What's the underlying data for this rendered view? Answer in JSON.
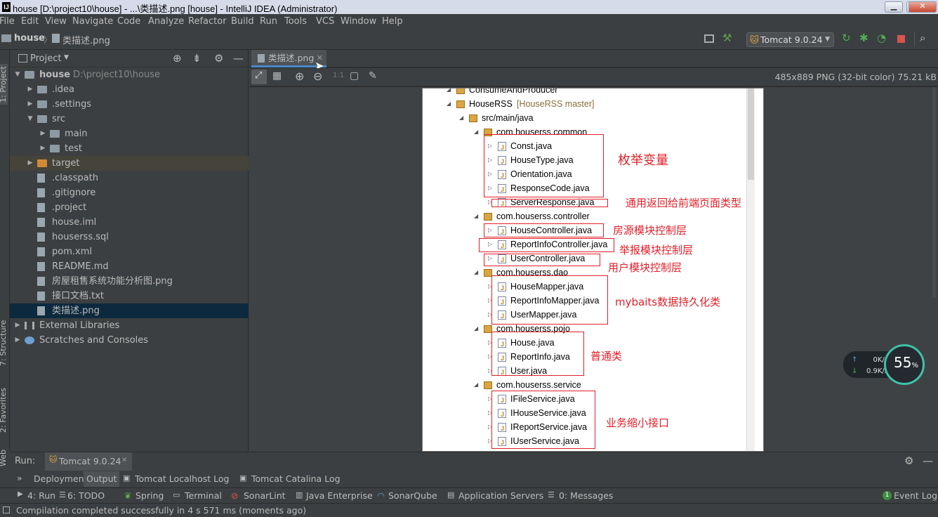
{
  "window": {
    "title": "house [D:\\project10\\house] - ...\\类描述.png [house] - IntelliJ IDEA (Administrator)",
    "logo": "IJ"
  },
  "menu": [
    "File",
    "Edit",
    "View",
    "Navigate",
    "Code",
    "Analyze",
    "Refactor",
    "Build",
    "Run",
    "Tools",
    "VCS",
    "Window",
    "Help"
  ],
  "breadcrumb": {
    "project": "house",
    "file": "类描述.png"
  },
  "toolbar": {
    "run_config": "Tomcat 9.0.24"
  },
  "left_stripe": {
    "project": "1: Project",
    "structure": "7: Structure",
    "favorites": "2: Favorites",
    "web": "Web"
  },
  "project_panel": {
    "title": "Project",
    "tree": [
      {
        "label": "house",
        "extra": "D:\\project10\\house",
        "indent": 0,
        "arrow": "open",
        "icon": "folder"
      },
      {
        "label": ".idea",
        "indent": 1,
        "arrow": "closed",
        "icon": "folder"
      },
      {
        "label": ".settings",
        "indent": 1,
        "arrow": "closed",
        "icon": "folder"
      },
      {
        "label": "src",
        "indent": 1,
        "arrow": "open",
        "icon": "folder"
      },
      {
        "label": "main",
        "indent": 2,
        "arrow": "closed",
        "icon": "folder"
      },
      {
        "label": "test",
        "indent": 2,
        "arrow": "closed",
        "icon": "folder"
      },
      {
        "label": "target",
        "indent": 1,
        "arrow": "closed",
        "icon": "folder-orange",
        "highlight": true
      },
      {
        "label": ".classpath",
        "indent": 1,
        "icon": "file"
      },
      {
        "label": ".gitignore",
        "indent": 1,
        "icon": "file"
      },
      {
        "label": ".project",
        "indent": 1,
        "icon": "file"
      },
      {
        "label": "house.iml",
        "indent": 1,
        "icon": "file"
      },
      {
        "label": "houserss.sql",
        "indent": 1,
        "icon": "file"
      },
      {
        "label": "pom.xml",
        "indent": 1,
        "icon": "file"
      },
      {
        "label": "README.md",
        "indent": 1,
        "icon": "file"
      },
      {
        "label": "房屋租售系统功能分析图.png",
        "indent": 1,
        "icon": "file"
      },
      {
        "label": "接口文档.txt",
        "indent": 1,
        "icon": "file"
      },
      {
        "label": "类描述.png",
        "indent": 1,
        "icon": "file",
        "selected": true
      },
      {
        "label": "External Libraries",
        "indent": 0,
        "arrow": "closed",
        "icon": "lib"
      },
      {
        "label": "Scratches and Consoles",
        "indent": 0,
        "arrow": "closed",
        "icon": "scratch"
      }
    ]
  },
  "editor": {
    "tab_label": "类描述.png",
    "image_info": "485x889 PNG (32-bit color) 75.21 kB",
    "zoom_label": "1:1"
  },
  "image": {
    "rows": [
      {
        "label": "ConsumeAndProducer",
        "level": 0,
        "type": "module"
      },
      {
        "label": "HouseRSS",
        "extra": "[HouseRSS master]",
        "level": 0,
        "type": "module"
      },
      {
        "label": "src/main/java",
        "level": 1,
        "type": "pkg"
      },
      {
        "label": "com.houserss.common",
        "level": 2,
        "type": "pkg"
      },
      {
        "label": "Const.java",
        "level": 3,
        "type": "java"
      },
      {
        "label": "HouseType.java",
        "level": 3,
        "type": "java"
      },
      {
        "label": "Orientation.java",
        "level": 3,
        "type": "java"
      },
      {
        "label": "ResponseCode.java",
        "level": 3,
        "type": "java"
      },
      {
        "label": "ServerResponse.java",
        "level": 3,
        "type": "java"
      },
      {
        "label": "com.houserss.controller",
        "level": 2,
        "type": "pkg"
      },
      {
        "label": "HouseController.java",
        "level": 3,
        "type": "java"
      },
      {
        "label": "ReportInfoController.java",
        "level": 3,
        "type": "java"
      },
      {
        "label": "UserController.java",
        "level": 3,
        "type": "java"
      },
      {
        "label": "com.houserss.dao",
        "level": 2,
        "type": "pkg"
      },
      {
        "label": "HouseMapper.java",
        "level": 3,
        "type": "java"
      },
      {
        "label": "ReportInfoMapper.java",
        "level": 3,
        "type": "java"
      },
      {
        "label": "UserMapper.java",
        "level": 3,
        "type": "java"
      },
      {
        "label": "com.houserss.pojo",
        "level": 2,
        "type": "pkg"
      },
      {
        "label": "House.java",
        "level": 3,
        "type": "java"
      },
      {
        "label": "ReportInfo.java",
        "level": 3,
        "type": "java"
      },
      {
        "label": "User.java",
        "level": 3,
        "type": "java"
      },
      {
        "label": "com.houserss.service",
        "level": 2,
        "type": "pkg"
      },
      {
        "label": "IFileService.java",
        "level": 3,
        "type": "java"
      },
      {
        "label": "IHouseService.java",
        "level": 3,
        "type": "java"
      },
      {
        "label": "IReportService.java",
        "level": 3,
        "type": "java"
      },
      {
        "label": "IUserService.java",
        "level": 3,
        "type": "java"
      }
    ],
    "annotations": {
      "enum": "枚举变量",
      "response": "通用返回给前端页面类型",
      "house_ctrl": "房源模块控制层",
      "report_ctrl": "举报模块控制层",
      "user_ctrl": "用户模块控制层",
      "mapper": "mybaits数据持久化类",
      "pojo": "普通类",
      "service": "业务缩小接口"
    }
  },
  "net_widget": {
    "up": "0K/s",
    "down": "0.9K/s",
    "percent": "55",
    "percent_sign": "%"
  },
  "run_panel": {
    "label": "Run:",
    "config_tab": "Tomcat 9.0.24",
    "tabs": [
      "Deployment",
      "Output",
      "Tomcat Localhost Log",
      "Tomcat Catalina Log"
    ]
  },
  "tool_windows": [
    "4: Run",
    "6: TODO",
    "Spring",
    "Terminal",
    "SonarLint",
    "Java Enterprise",
    "SonarQube",
    "Application Servers",
    "0: Messages"
  ],
  "event_log": {
    "badge": "1",
    "label": "Event Log"
  },
  "status": "Compilation completed successfully in 4 s 571 ms (moments ago)",
  "colors": {
    "accent": "#4a88c7",
    "selection": "#0d293e",
    "annotation_red": "#e0202a"
  }
}
